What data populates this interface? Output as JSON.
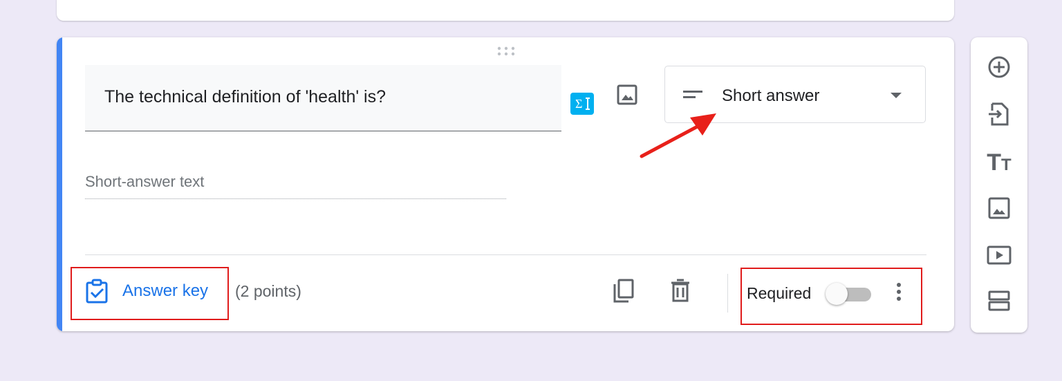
{
  "question": {
    "title": "The technical definition of 'health' is?",
    "type_label": "Short answer",
    "answer_placeholder": "Short-answer text"
  },
  "footer": {
    "answer_key_label": "Answer key",
    "points_text": "(2 points)",
    "required_label": "Required",
    "required_on": false
  },
  "icons": {
    "drag": "drag-dots-icon",
    "equation": "equation-icon",
    "image": "image-icon",
    "type": "short-text-icon",
    "dropdown": "dropdown-arrow-icon",
    "answer_key": "assignment-check-icon",
    "copy": "copy-icon",
    "delete": "trash-icon",
    "more": "more-vert-icon"
  },
  "toolbar": [
    "add-question-icon",
    "import-questions-icon",
    "add-title-icon",
    "add-image-icon",
    "add-video-icon",
    "add-section-icon"
  ],
  "colors": {
    "accent": "#4285f4",
    "link": "#1a73e8",
    "annotation": "#e01b1b",
    "equation_bg": "#00b0f0"
  }
}
